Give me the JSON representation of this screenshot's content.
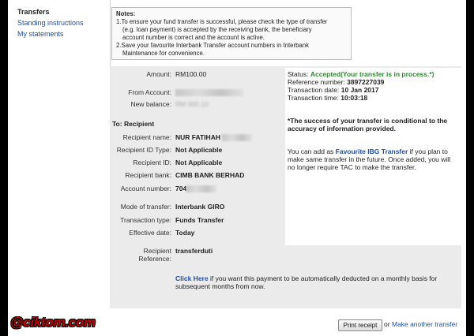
{
  "sidebar": {
    "current": "Transfers",
    "items": [
      "Standing instructions",
      "My statements"
    ]
  },
  "notes": {
    "heading": "Notes:",
    "line1": "1.To ensure your fund transfer is successful, please check the type of transfer",
    "line2": "(e.g. loan payment) is accepted by the receiving bank, the beneficiary",
    "line3": "account number is correct and the account is active.",
    "line4": "2.Save your favourite Interbank Transfer account numbers in Interbank",
    "line5": "Maintenance for convenience."
  },
  "details": {
    "amount_label": "Amount:",
    "amount_value": "RM100.00",
    "from_account_label": "From Account:",
    "new_balance_label": "New balance:",
    "new_balance_partial": "RM 000.10",
    "to_label": "To: Recipient",
    "recipient_name_label": "Recipient name:",
    "recipient_name_value": "NUR FATIHAH",
    "recipient_id_type_label": "Recipient ID Type:",
    "recipient_id_type_value": "Not Applicable",
    "recipient_id_label": "Recipient ID:",
    "recipient_id_value": "Not Applicable",
    "recipient_bank_label": "Recipient bank:",
    "recipient_bank_value": "CIMB BANK BERHAD",
    "account_number_label": "Account number:",
    "account_number_value": "704",
    "mode_label": "Mode of transfer:",
    "mode_value": "Interbank GIRO",
    "transaction_type_label": "Transaction type:",
    "transaction_type_value": "Funds Transfer",
    "effective_date_label": "Effective date:",
    "effective_date_value": "Today",
    "recipient_reference_label_1": "Recipient",
    "recipient_reference_label_2": "Reference:",
    "recipient_reference_value": "transferduti"
  },
  "status": {
    "status_label": "Status:",
    "status_value": "Accepted(Your transfer is in process.*)",
    "reference_label": "Reference number:",
    "reference_value": "3897227039",
    "date_label": "Transaction date:",
    "date_value": "10 Jan 2017",
    "time_label": "Transaction time:",
    "time_value": "10:03:18",
    "disclaimer_1": "*The success of your transfer is conditional to the",
    "disclaimer_2": "accuracy of information provided.",
    "fav_1_pre": "You can add as ",
    "fav_1_link": "Favourite IBG Transfer",
    "fav_1_post": " if you plan to",
    "fav_2": "make same transfer in the future. Once added, you will",
    "fav_3": "no longer require TAC to make the transfer."
  },
  "auto": {
    "link": "Click Here",
    "text_1": " if you want this payment to be automatically deducted on a monthly basis for",
    "text_2": "subsequent months from now."
  },
  "actions": {
    "print_label": "Print receipt",
    "or_label": "or",
    "another_label": "Make another transfer"
  },
  "watermark": "@ciktom.com"
}
